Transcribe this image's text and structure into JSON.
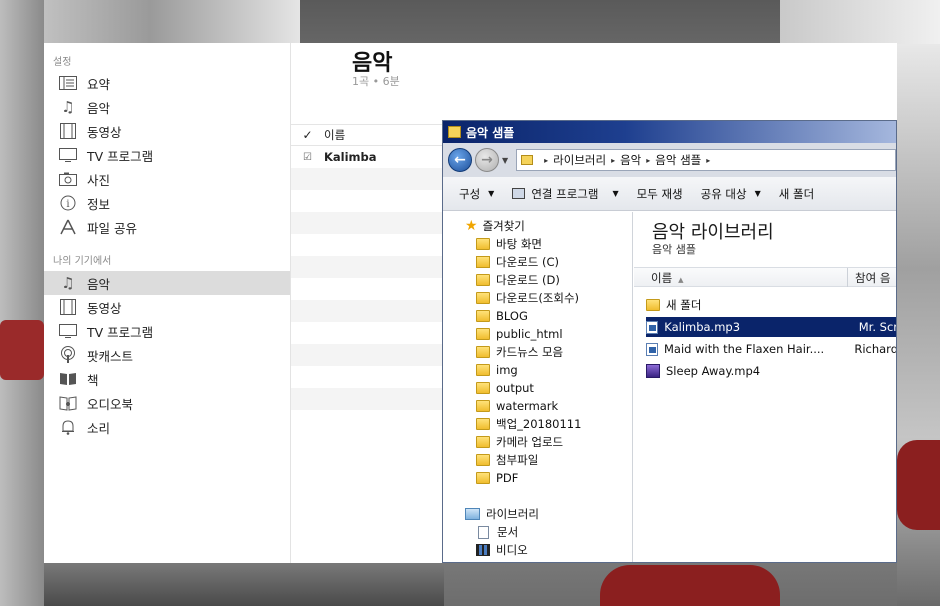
{
  "itunes": {
    "sidebar": {
      "settings_title": "설정",
      "settings_items": [
        {
          "label": "요약",
          "icon": "summary-icon"
        },
        {
          "label": "음악",
          "icon": "music-note-icon"
        },
        {
          "label": "동영상",
          "icon": "film-icon"
        },
        {
          "label": "TV 프로그램",
          "icon": "tv-icon"
        },
        {
          "label": "사진",
          "icon": "camera-icon"
        },
        {
          "label": "정보",
          "icon": "info-icon"
        },
        {
          "label": "파일 공유",
          "icon": "apps-icon"
        }
      ],
      "device_title": "나의 기기에서",
      "device_items": [
        {
          "label": "음악",
          "icon": "music-note-icon",
          "active": true
        },
        {
          "label": "동영상",
          "icon": "film-icon"
        },
        {
          "label": "TV 프로그램",
          "icon": "tv-icon"
        },
        {
          "label": "팟캐스트",
          "icon": "podcast-icon"
        },
        {
          "label": "책",
          "icon": "book-icon"
        },
        {
          "label": "오디오북",
          "icon": "audiobook-icon"
        },
        {
          "label": "소리",
          "icon": "bell-icon"
        }
      ]
    },
    "main": {
      "title": "음악",
      "subtitle": "1곡 • 6분",
      "column_header": "이름",
      "rows": [
        {
          "checked": true,
          "name": "Kalimba"
        }
      ]
    }
  },
  "explorer": {
    "window_title": "음악 샘플",
    "address": [
      "라이브러리",
      "음악",
      "음악 샘플"
    ],
    "toolbar": {
      "organize": "구성",
      "open_with": "연결 프로그램",
      "play_all": "모두 재생",
      "share_with": "공유 대상",
      "new_folder": "새 폴더"
    },
    "tree": {
      "favorites_label": "즐겨찾기",
      "favorites": [
        "바탕 화면",
        "다운로드 (C)",
        "다운로드 (D)",
        "다운로드(조회수)",
        "BLOG",
        "public_html",
        "카드뉴스 모음",
        "img",
        "output",
        "watermark",
        "백업_20180111",
        "카메라 업로드",
        "첨부파일",
        "PDF"
      ],
      "libraries_label": "라이브러리",
      "libraries": [
        "문서",
        "비디오"
      ]
    },
    "pane": {
      "title": "음악 라이브러리",
      "subtitle": "음악 샘플",
      "col_name": "이름",
      "col_artist": "참여 음",
      "files": [
        {
          "name": "새 폴더",
          "artist": "",
          "type": "folder",
          "selected": false
        },
        {
          "name": "Kalimba.mp3",
          "artist": "Mr. Scr",
          "type": "mp3",
          "selected": true
        },
        {
          "name": "Maid with the Flaxen Hair....",
          "artist": "Richard",
          "type": "mp3",
          "selected": false
        },
        {
          "name": "Sleep Away.mp4",
          "artist": "",
          "type": "mp4",
          "selected": false
        }
      ]
    }
  }
}
